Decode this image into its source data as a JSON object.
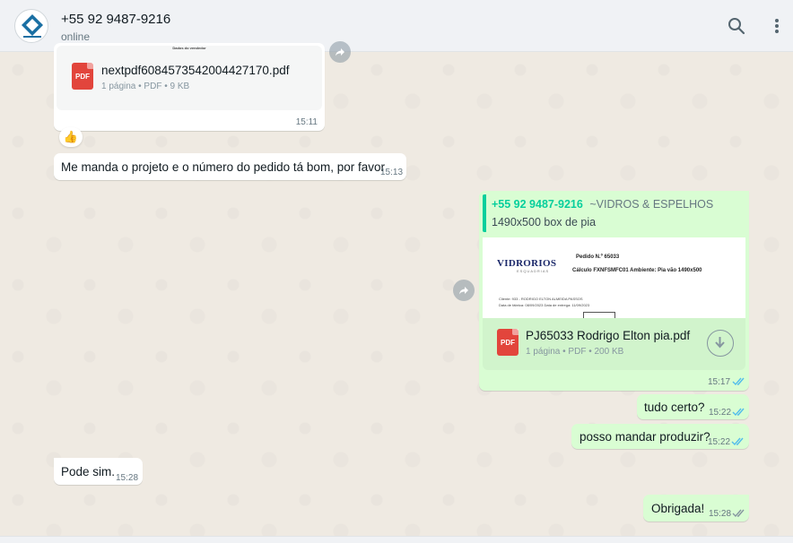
{
  "header": {
    "title": "+55 92 9487-9216",
    "status": "online"
  },
  "messages": {
    "m1": {
      "doc_name": "nextpdf6084573542004427170.pdf",
      "doc_meta": "1 página • PDF • 9 KB",
      "preview_caption": "Dados do vendedor",
      "time": "15:11"
    },
    "m2": {
      "emoji": "👍"
    },
    "m3": {
      "text": "Me manda o projeto e o número do pedido tá bom, por favor",
      "time": "15:13"
    },
    "m4": {
      "sender": "+55 92 9487-9216",
      "sender_tag": "~VIDROS & ESPELHOS",
      "caption": "1490x500 box de pia",
      "preview": {
        "brand": "VIDRORIOS",
        "brand_sub": "ESQUADRIAS",
        "order": "Pedido N.º 65033",
        "calc": "Cálculo FXNFSMFC01 Ambiente: Pia vão 1490x500",
        "client": "Cliente:    933 - RODRIGO ELTON ALMEIDA PASSOS",
        "dates": "Data de fábrica: 08/09/2023    Data de entrega: 11/09/2023"
      },
      "doc_name": "PJ65033 Rodrigo Elton pia.pdf",
      "doc_meta": "1 página • PDF • 200 KB",
      "time": "15:17"
    },
    "m5": {
      "text": "tudo certo?",
      "time": "15:22"
    },
    "m6": {
      "text": "posso mandar produzir?",
      "time": "15:22"
    },
    "m7": {
      "text": "Pode sim.",
      "time": "15:28"
    },
    "m8": {
      "text": "Obrigada!",
      "time": "15:28"
    }
  },
  "icons": {
    "search": "search-icon",
    "menu": "kebab-menu-icon",
    "forward": "forward-icon",
    "download": "download-icon",
    "pdf": "pdf-icon",
    "read": "double-check-icon"
  },
  "colors": {
    "incoming": "#ffffff",
    "outgoing": "#d9fdd3",
    "read_ticks": "#53bdeb",
    "sender_name": "#06cf9c",
    "pdf_red": "#e2453c"
  }
}
